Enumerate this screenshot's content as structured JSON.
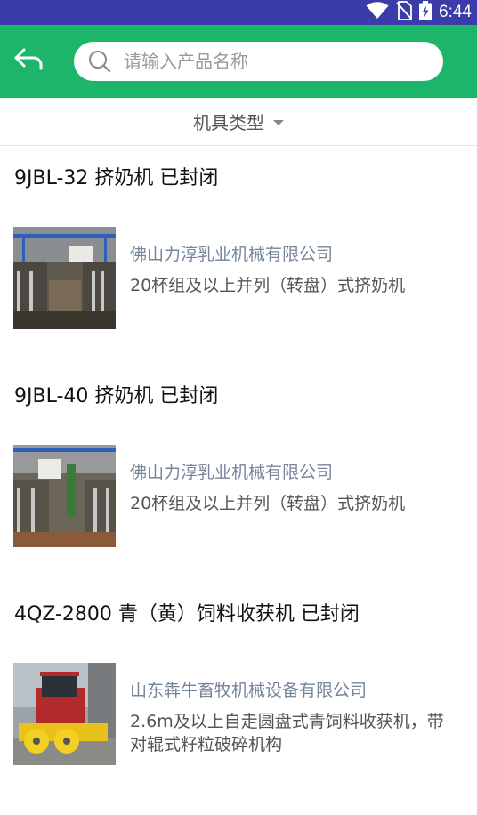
{
  "status_bar": {
    "time": "6:44",
    "icons": [
      "wifi-icon",
      "no-sim-icon",
      "battery-charging-icon"
    ],
    "color": "#3c3ca8"
  },
  "header": {
    "color": "#1db56a",
    "search_placeholder": "请输入产品名称",
    "search_value": ""
  },
  "filter": {
    "label": "机具类型"
  },
  "items": [
    {
      "title": "9JBL-32 挤奶机 已封闭",
      "company": "佛山力淳乳业机械有限公司",
      "desc_line1": "20杯组及以上并列（转盘）式挤奶机",
      "desc_line2": ""
    },
    {
      "title": "9JBL-40 挤奶机 已封闭",
      "company": "佛山力淳乳业机械有限公司",
      "desc_line1": "20杯组及以上并列（转盘）式挤奶机",
      "desc_line2": ""
    },
    {
      "title": "4QZ-2800 青（黄）饲料收获机 已封闭",
      "company": "山东犇牛畜牧机械设备有限公司",
      "desc_line1": "2.6m及以上自走圆盘式青饲料收获机，带",
      "desc_line2": "对辊式籽粒破碎机构"
    }
  ]
}
